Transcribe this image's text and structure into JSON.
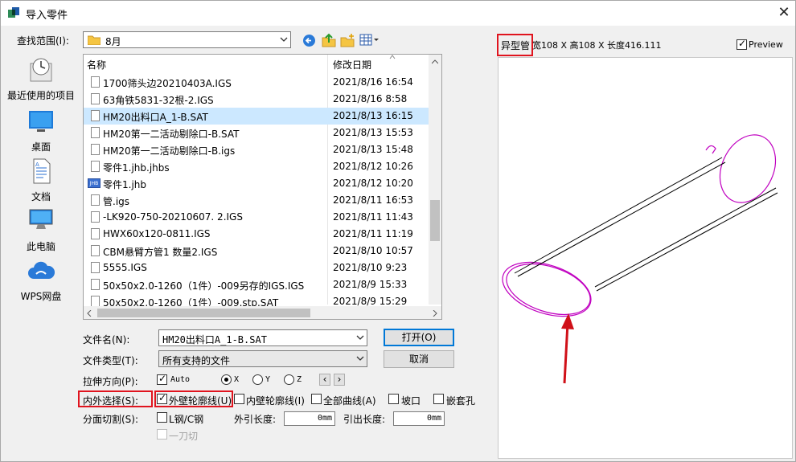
{
  "window": {
    "title": "导入零件",
    "close": "✕"
  },
  "toolbar": {
    "look_in_label": "查找范围(I):",
    "look_in_value": "8月"
  },
  "places": [
    {
      "label": "最近使用的项目",
      "icon": "recent-icon"
    },
    {
      "label": "桌面",
      "icon": "desktop-icon"
    },
    {
      "label": "文档",
      "icon": "documents-icon"
    },
    {
      "label": "此电脑",
      "icon": "computer-icon"
    },
    {
      "label": "WPS网盘",
      "icon": "cloud-icon"
    }
  ],
  "filelist": {
    "col_name": "名称",
    "col_date": "修改日期",
    "rows": [
      {
        "name": "1700筛头边20210403A.IGS",
        "date": "2021/8/16 16:54"
      },
      {
        "name": "63角铁5831-32根-2.IGS",
        "date": "2021/8/16 8:58"
      },
      {
        "name": "HM20出料口A_1-B.SAT",
        "date": "2021/8/13 16:15",
        "selected": true
      },
      {
        "name": "HM20第一二活动剔除口-B.SAT",
        "date": "2021/8/13 15:53"
      },
      {
        "name": "HM20第一二活动剔除口-B.igs",
        "date": "2021/8/13 15:48"
      },
      {
        "name": "零件1.jhb.jhbs",
        "date": "2021/8/12 10:26"
      },
      {
        "name": "零件1.jhb",
        "date": "2021/8/12 10:20",
        "icon": "JHB"
      },
      {
        "name": "管.igs",
        "date": "2021/8/11 16:53"
      },
      {
        "name": "-LK920-750-20210607. 2.IGS",
        "date": "2021/8/11 11:43"
      },
      {
        "name": "HWX60x120-0811.IGS",
        "date": "2021/8/11 11:19"
      },
      {
        "name": "CBM悬臂方管1 数量2.IGS",
        "date": "2021/8/10 10:57"
      },
      {
        "name": "5555.IGS",
        "date": "2021/8/10 9:23"
      },
      {
        "name": "50x50x2.0-1260（1件）-009另存的IGS.IGS",
        "date": "2021/8/9 15:33"
      },
      {
        "name": "50x50x2.0-1260（1件）-009.stp.SAT",
        "date": "2021/8/9 15:29"
      }
    ]
  },
  "form": {
    "filename_label": "文件名(N):",
    "filename_value": "HM20出料口A_1-B.SAT",
    "filetype_label": "文件类型(T):",
    "filetype_value": "所有支持的文件",
    "open_label": "打开(O)",
    "cancel_label": "取消",
    "stretch_label": "拉伸方向(P):",
    "auto_label": "Auto",
    "radio_x": "X",
    "radio_y": "Y",
    "radio_z": "Z",
    "prev_arrow": "‹",
    "next_arrow": "›",
    "inout_label": "内外选择(S):",
    "outer_label": "外壁轮廓线(U)",
    "inner_label": "内壁轮廓线(I)",
    "all_label": "全部曲线(A)",
    "slope_label": "坡口",
    "nest_label": "嵌套孔",
    "split_label": "分面切割(S):",
    "lsteel_label": "L钢/C钢",
    "lead_out_label": "外引长度:",
    "lead_out_value": "0mm",
    "lead_in_label": "引出长度:",
    "lead_in_value": "0mm",
    "one_cut_label": "一刀切"
  },
  "preview": {
    "type_label": "异型管",
    "dims": "宽108 X 高108 X 长度416.111",
    "preview_label": "Preview"
  },
  "colors": {
    "accent": "#0078d7",
    "highlight": "#e0141e",
    "curve": "#c000c0",
    "selection": "#cce8ff"
  }
}
